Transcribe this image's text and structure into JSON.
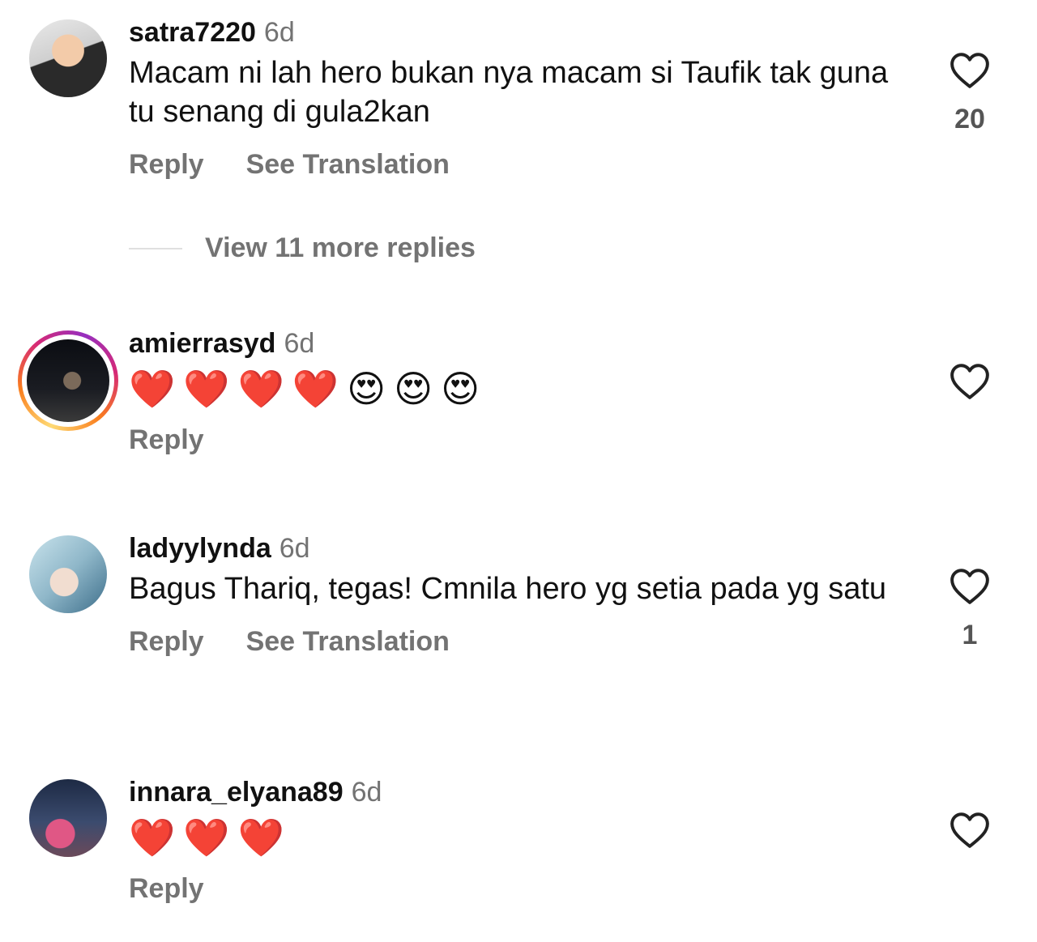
{
  "comments": [
    {
      "username": "satra7220",
      "time": "6d",
      "text": "Macam ni lah hero bukan nya macam si Taufik tak guna tu senang di gula2kan",
      "likes": "20",
      "actions": {
        "reply": "Reply",
        "translate": "See Translation"
      },
      "view_replies": "View 11 more replies"
    },
    {
      "username": "amierrasyd",
      "time": "6d",
      "emojis": [
        "❤️",
        "❤️",
        "❤️",
        "❤️",
        "😍",
        "😍",
        "😍"
      ],
      "actions": {
        "reply": "Reply"
      }
    },
    {
      "username": "ladyylynda",
      "time": "6d",
      "text": "Bagus Thariq, tegas! Cmnila hero yg setia pada yg satu",
      "likes": "1",
      "actions": {
        "reply": "Reply",
        "translate": "See Translation"
      }
    },
    {
      "username": "innara_elyana89",
      "time": "6d",
      "emojis": [
        "❤️",
        "❤️",
        "❤️"
      ],
      "actions": {
        "reply": "Reply"
      }
    }
  ],
  "icons": {
    "like": "heart-outline-icon"
  },
  "colors": {
    "secondary_text": "#737373",
    "story_ring_start": "#feda75",
    "story_ring_end": "#962fbf"
  }
}
